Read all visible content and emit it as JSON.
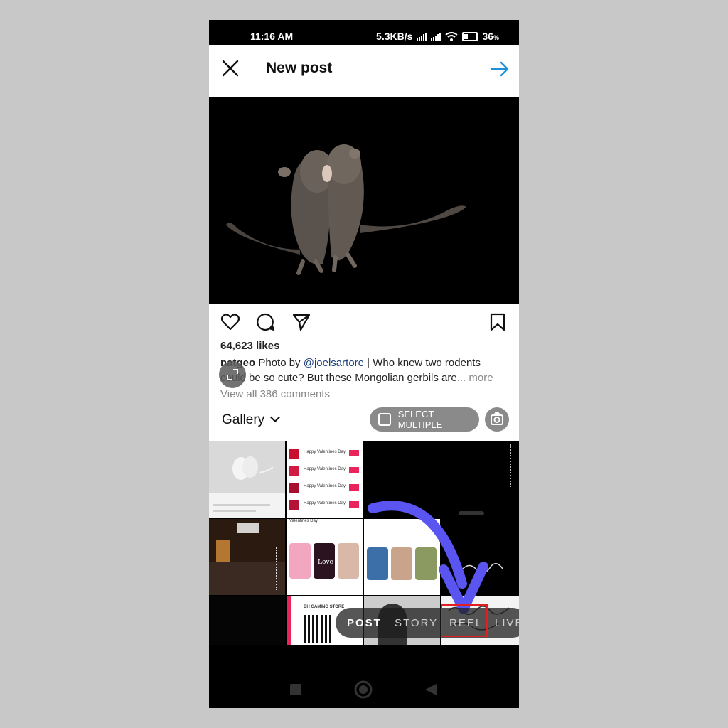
{
  "status_bar": {
    "time": "11:16 AM",
    "network_speed": "5.3KB/s",
    "battery": "36",
    "battery_unit": "%"
  },
  "header": {
    "title": "New post",
    "close_icon": "close-icon",
    "next_icon": "arrow-right-icon",
    "accent_color": "#1e90d6"
  },
  "post": {
    "likes": "64,623 likes",
    "username": "natgeo",
    "caption_prefix": "Photo by ",
    "mention": "@joelsartore",
    "caption_line1_rest": " | Who knew two rodents",
    "caption_line2": "could be so cute? But these Mongolian gerbils are",
    "ellipsis_more": "... more",
    "view_comments": "View all 386 comments"
  },
  "gallery": {
    "label": "Gallery",
    "select_multiple": "SELECT MULTIPLE"
  },
  "thumbs": {
    "valentine_item": "Happy Valentines Day",
    "valentine_item_2": "Valentines Day",
    "gaming_store": "BH GAMING STORE",
    "love_text": "Love"
  },
  "modes": {
    "post": "POST",
    "story": "STORY",
    "reel": "REEL",
    "live": "LIVE",
    "active": "POST",
    "highlight_color": "#e02020"
  },
  "annotation": {
    "arrow_color": "#5a55f0"
  }
}
